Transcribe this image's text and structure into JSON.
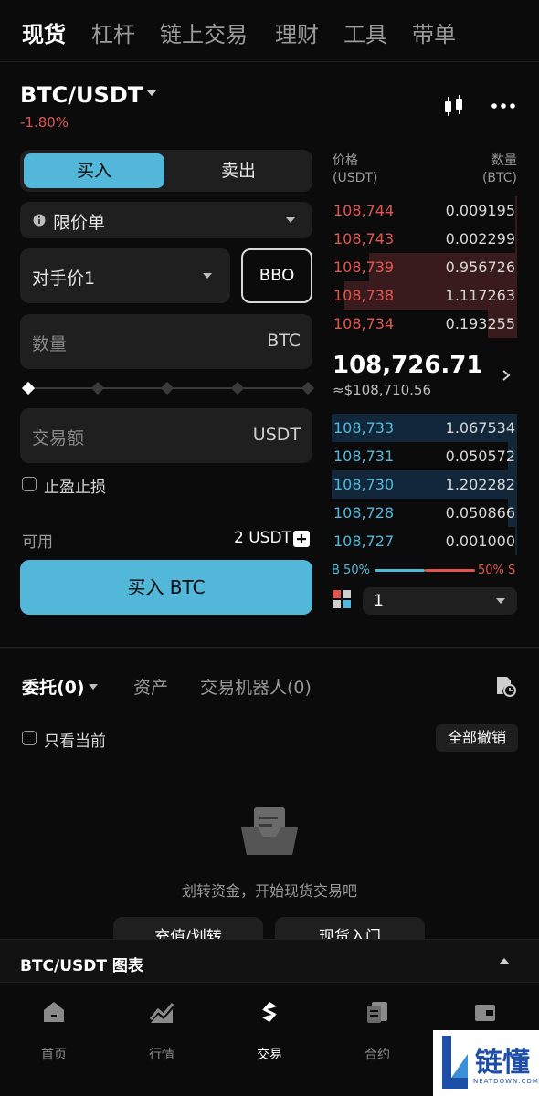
{
  "top_tabs": [
    "现货",
    "杠杆",
    "链上交易",
    "理财",
    "工具",
    "带单"
  ],
  "pair": {
    "name": "BTC/USDT",
    "change": "-1.80%"
  },
  "trade": {
    "buy_tab": "买入",
    "sell_tab": "卖出",
    "order_type": "限价单",
    "price_mode": "对手价1",
    "bbo": "BBO",
    "quantity_placeholder": "数量",
    "quantity_unit": "BTC",
    "amount_placeholder": "交易额",
    "amount_unit": "USDT",
    "tp_sl": "止盈止损",
    "available_label": "可用",
    "available_value": "2 USDT",
    "submit": "买入 BTC"
  },
  "order_book": {
    "price_header": [
      "价格",
      "(USDT)"
    ],
    "qty_header": [
      "数量",
      "(BTC)"
    ],
    "asks": [
      {
        "price": "108,744",
        "qty": "0.009195",
        "depth": 0.01
      },
      {
        "price": "108,743",
        "qty": "0.002299",
        "depth": 0.01
      },
      {
        "price": "108,739",
        "qty": "0.956726",
        "depth": 0.8
      },
      {
        "price": "108,738",
        "qty": "1.117263",
        "depth": 0.93
      },
      {
        "price": "108,734",
        "qty": "0.193255",
        "depth": 0.16
      }
    ],
    "mid_price": "108,726.71",
    "mid_usd": "≈$108,710.56",
    "bids": [
      {
        "price": "108,733",
        "qty": "1.067534",
        "depth": 1.0
      },
      {
        "price": "108,731",
        "qty": "0.050572",
        "depth": 0.05
      },
      {
        "price": "108,730",
        "qty": "1.202282",
        "depth": 1.0
      },
      {
        "price": "108,728",
        "qty": "0.050866",
        "depth": 0.05
      },
      {
        "price": "108,727",
        "qty": "0.001000",
        "depth": 0.01
      }
    ],
    "buy_ratio": "B 50%",
    "sell_ratio": "50% S",
    "depth_value": "1"
  },
  "orders": {
    "tabs": [
      "委托(0)",
      "资产",
      "交易机器人(0)"
    ],
    "only_current": "只看当前",
    "cancel_all": "全部撤销",
    "empty_text": "划转资金，开始现货交易吧",
    "button_deposit": "充值/划转",
    "button_intro": "现货入门"
  },
  "chart_bar": {
    "label": "BTC/USDT 图表"
  },
  "bottom_nav": [
    {
      "label": "首页",
      "icon": "home-icon"
    },
    {
      "label": "行情",
      "icon": "market-icon"
    },
    {
      "label": "交易",
      "icon": "trade-icon"
    },
    {
      "label": "合约",
      "icon": "contract-icon"
    },
    {
      "label": "",
      "icon": "wallet-icon"
    }
  ],
  "watermark": {
    "text": "链懂",
    "sub": "NEATDOWN.COM"
  },
  "colors": {
    "accent": "#52b7d8",
    "sell": "#e0564f",
    "bg": "#0b0b0b"
  }
}
